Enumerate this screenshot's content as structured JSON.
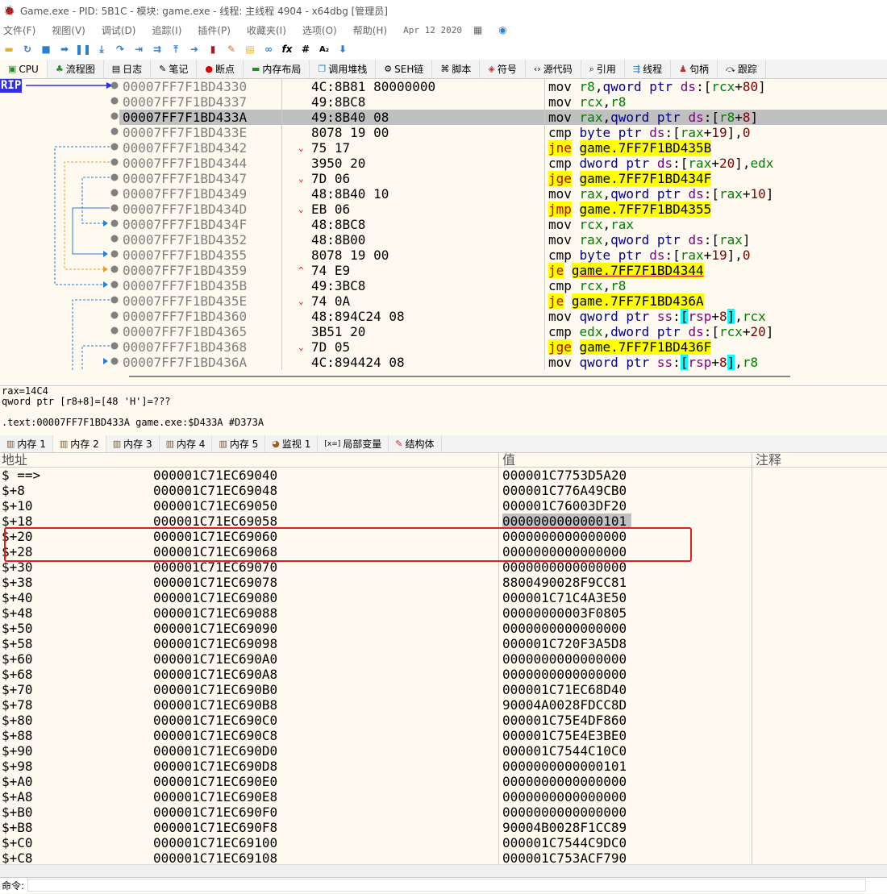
{
  "window": {
    "title": "Game.exe - PID: 5B1C - 模块: game.exe - 线程: 主线程 4904 - x64dbg [管理员]"
  },
  "menu": {
    "items": [
      "文件(F)",
      "视图(V)",
      "调试(D)",
      "追踪(I)",
      "插件(P)",
      "收藏夹(I)",
      "选项(O)",
      "帮助(H)"
    ],
    "date": "Apr 12 2020"
  },
  "main_tabs": [
    {
      "label": "CPU",
      "icon": "cpu-icon"
    },
    {
      "label": "流程图",
      "icon": "graph-icon"
    },
    {
      "label": "日志",
      "icon": "log-icon"
    },
    {
      "label": "笔记",
      "icon": "notes-icon"
    },
    {
      "label": "断点",
      "icon": "breakpoint-icon"
    },
    {
      "label": "内存布局",
      "icon": "memory-map-icon"
    },
    {
      "label": "调用堆栈",
      "icon": "callstack-icon"
    },
    {
      "label": "SEH链",
      "icon": "seh-icon"
    },
    {
      "label": "脚本",
      "icon": "script-icon"
    },
    {
      "label": "符号",
      "icon": "symbols-icon"
    },
    {
      "label": "源代码",
      "icon": "source-icon"
    },
    {
      "label": "引用",
      "icon": "references-icon"
    },
    {
      "label": "线程",
      "icon": "threads-icon"
    },
    {
      "label": "句柄",
      "icon": "handles-icon"
    },
    {
      "label": "跟踪",
      "icon": "trace-icon"
    }
  ],
  "rip_label": "RIP",
  "disasm": [
    {
      "addr": "00007FF7F1BD4330",
      "mark": "",
      "bytes": "4C:8B81 80000000"
    },
    {
      "addr": "00007FF7F1BD4337",
      "mark": "",
      "bytes": "49:8BC8"
    },
    {
      "addr": "00007FF7F1BD433A",
      "mark": "",
      "bytes": "49:8B40 08"
    },
    {
      "addr": "00007FF7F1BD433E",
      "mark": "",
      "bytes": "8078 19 00"
    },
    {
      "addr": "00007FF7F1BD4342",
      "mark": "⌄",
      "bytes": "75 17"
    },
    {
      "addr": "00007FF7F1BD4344",
      "mark": "",
      "bytes": "3950 20"
    },
    {
      "addr": "00007FF7F1BD4347",
      "mark": "⌄",
      "bytes": "7D 06"
    },
    {
      "addr": "00007FF7F1BD4349",
      "mark": "",
      "bytes": "48:8B40 10"
    },
    {
      "addr": "00007FF7F1BD434D",
      "mark": "⌄",
      "bytes": "EB 06"
    },
    {
      "addr": "00007FF7F1BD434F",
      "mark": "",
      "bytes": "48:8BC8"
    },
    {
      "addr": "00007FF7F1BD4352",
      "mark": "",
      "bytes": "48:8B00"
    },
    {
      "addr": "00007FF7F1BD4355",
      "mark": "",
      "bytes": "8078 19 00"
    },
    {
      "addr": "00007FF7F1BD4359",
      "mark": "^",
      "bytes": "74 E9"
    },
    {
      "addr": "00007FF7F1BD435B",
      "mark": "",
      "bytes": "49:3BC8"
    },
    {
      "addr": "00007FF7F1BD435E",
      "mark": "⌄",
      "bytes": "74 0A"
    },
    {
      "addr": "00007FF7F1BD4360",
      "mark": "",
      "bytes": "48:894C24 08"
    },
    {
      "addr": "00007FF7F1BD4365",
      "mark": "",
      "bytes": "3B51 20"
    },
    {
      "addr": "00007FF7F1BD4368",
      "mark": "⌄",
      "bytes": "7D 05"
    },
    {
      "addr": "00007FF7F1BD436A",
      "mark": "",
      "bytes": "4C:894424 08"
    }
  ],
  "asm": {
    "l0": [
      "mov",
      "r8",
      ",",
      "qword ptr",
      "ds",
      ":[",
      "rcx",
      "+",
      "80",
      "]"
    ],
    "l1": [
      "mov",
      "rcx",
      ",",
      "r8"
    ],
    "l2": [
      "mov",
      "rax",
      ",",
      "qword ptr",
      "ds",
      ":[",
      "r8",
      "+",
      "8",
      "]"
    ],
    "l3": [
      "cmp",
      "byte ptr",
      "ds",
      ":[",
      "rax",
      "+",
      "19",
      "],",
      "0"
    ],
    "l4": [
      "jne",
      "game.7FF7F1BD435B"
    ],
    "l5": [
      "cmp",
      "dword ptr",
      "ds",
      ":[",
      "rax",
      "+",
      "20",
      "],",
      "edx"
    ],
    "l6": [
      "jge",
      "game.7FF7F1BD434F"
    ],
    "l7": [
      "mov",
      "rax",
      ",",
      "qword ptr",
      "ds",
      ":[",
      "rax",
      "+",
      "10",
      "]"
    ],
    "l8": [
      "jmp",
      "game.7FF7F1BD4355"
    ],
    "l9": [
      "mov",
      "rcx",
      ",",
      "rax"
    ],
    "l10": [
      "mov",
      "rax",
      ",",
      "qword ptr",
      "ds",
      ":[",
      "rax",
      "]"
    ],
    "l11": [
      "cmp",
      "byte ptr",
      "ds",
      ":[",
      "rax",
      "+",
      "19",
      "],",
      "0"
    ],
    "l12": [
      "je",
      "game.7FF7F1BD4344"
    ],
    "l13": [
      "cmp",
      "rcx",
      ",",
      "r8"
    ],
    "l14": [
      "je",
      "game.7FF7F1BD436A"
    ],
    "l15": [
      "mov",
      "qword ptr",
      "ss",
      ":",
      "[",
      "rsp",
      "+",
      "8",
      "]",
      ",",
      "rcx"
    ],
    "l16": [
      "cmp",
      "edx",
      ",",
      "dword ptr",
      "ds",
      ":[",
      "rcx",
      "+",
      "20",
      "]"
    ],
    "l17": [
      "jge",
      "game.7FF7F1BD436F"
    ],
    "l18": [
      "mov",
      "qword ptr",
      "ss",
      ":",
      "[",
      "rsp",
      "+",
      "8",
      "]",
      ",",
      "r8"
    ]
  },
  "info": {
    "line1": "rax=14C4",
    "line2": "qword ptr [r8+8]=[48 'H']=???",
    "line3": ".text:00007FF7F1BD433A game.exe:$D433A #D373A"
  },
  "dump_tabs": [
    {
      "label": "内存 1",
      "icon": "memory-icon"
    },
    {
      "label": "内存 2",
      "icon": "memory-icon"
    },
    {
      "label": "内存 3",
      "icon": "memory-icon"
    },
    {
      "label": "内存 4",
      "icon": "memory-icon"
    },
    {
      "label": "内存 5",
      "icon": "memory-icon"
    },
    {
      "label": "监视 1",
      "icon": "watch-icon"
    },
    {
      "label": "局部变量",
      "icon": "locals-icon"
    },
    {
      "label": "结构体",
      "icon": "struct-icon"
    }
  ],
  "dump_headers": {
    "addr": "地址",
    "value": "值",
    "comment": "注释"
  },
  "dump_rows": [
    [
      "$ ==>",
      "000001C71EC69040",
      "000001C7753D5A20"
    ],
    [
      "$+8",
      "000001C71EC69048",
      "000001C776A49CB0"
    ],
    [
      "$+10",
      "000001C71EC69050",
      "000001C76003DF20"
    ],
    [
      "$+18",
      "000001C71EC69058",
      "0000000000000101"
    ],
    [
      "$+20",
      "000001C71EC69060",
      "0000000000000000"
    ],
    [
      "$+28",
      "000001C71EC69068",
      "0000000000000000"
    ],
    [
      "$+30",
      "000001C71EC69070",
      "0000000000000000"
    ],
    [
      "$+38",
      "000001C71EC69078",
      "8800490028F9CC81"
    ],
    [
      "$+40",
      "000001C71EC69080",
      "000001C71C4A3E50"
    ],
    [
      "$+48",
      "000001C71EC69088",
      "00000000003F0805"
    ],
    [
      "$+50",
      "000001C71EC69090",
      "0000000000000000"
    ],
    [
      "$+58",
      "000001C71EC69098",
      "000001C720F3A5D8"
    ],
    [
      "$+60",
      "000001C71EC690A0",
      "0000000000000000"
    ],
    [
      "$+68",
      "000001C71EC690A8",
      "0000000000000000"
    ],
    [
      "$+70",
      "000001C71EC690B0",
      "000001C71EC68D40"
    ],
    [
      "$+78",
      "000001C71EC690B8",
      "90004A0028FDCC8D"
    ],
    [
      "$+80",
      "000001C71EC690C0",
      "000001C75E4DF860"
    ],
    [
      "$+88",
      "000001C71EC690C8",
      "000001C75E4E3BE0"
    ],
    [
      "$+90",
      "000001C71EC690D0",
      "000001C7544C10C0"
    ],
    [
      "$+98",
      "000001C71EC690D8",
      "0000000000000101"
    ],
    [
      "$+A0",
      "000001C71EC690E0",
      "0000000000000000"
    ],
    [
      "$+A8",
      "000001C71EC690E8",
      "0000000000000000"
    ],
    [
      "$+B0",
      "000001C71EC690F0",
      "0000000000000000"
    ],
    [
      "$+B8",
      "000001C71EC690F8",
      "90004B0028F1CC89"
    ],
    [
      "$+C0",
      "000001C71EC69100",
      "000001C7544C9DC0"
    ],
    [
      "$+C8",
      "000001C71EC69108",
      "000001C753ACF790"
    ]
  ],
  "command": {
    "label": "命令:",
    "value": ""
  },
  "colors": {
    "selected_row": "#c0c0c0",
    "jump_highlight": "#ffff00",
    "rip": "#3030e0",
    "annotation_box": "#e02020"
  }
}
